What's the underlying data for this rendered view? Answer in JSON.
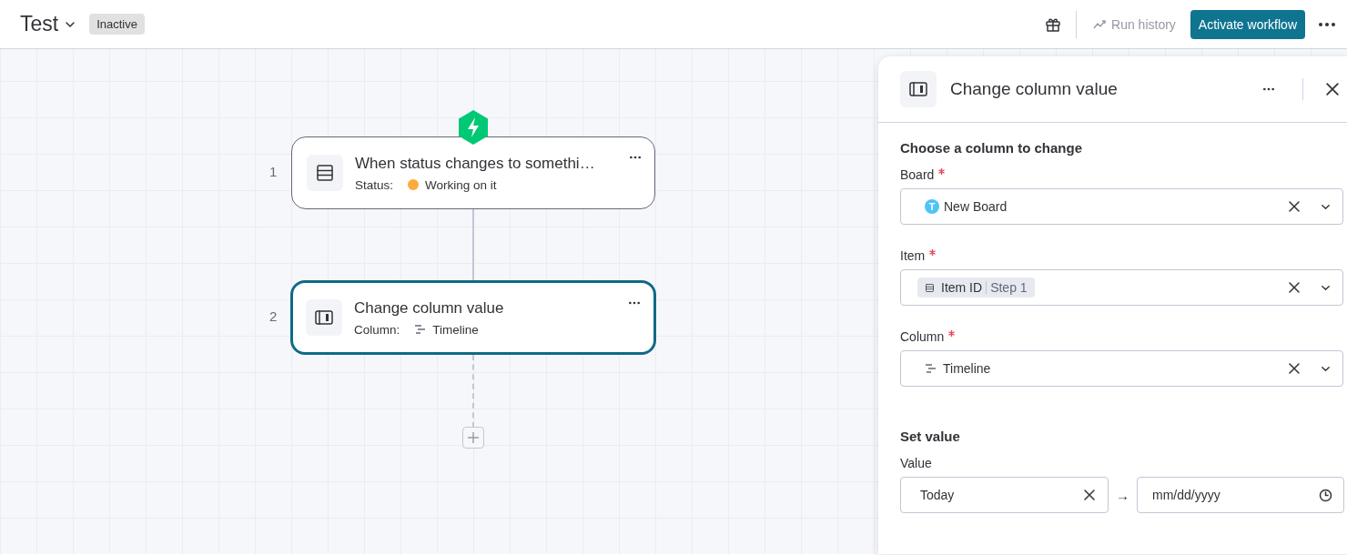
{
  "header": {
    "title": "Test",
    "status_badge": "Inactive",
    "run_history": "Run history",
    "activate_button": "Activate workflow"
  },
  "canvas": {
    "nodes": [
      {
        "number": "1",
        "kind": "trigger",
        "title": "When status changes to somethi…",
        "detail_label": "Status:",
        "detail_value": "Working on it",
        "color": "#fdab3d",
        "selected": false
      },
      {
        "number": "2",
        "kind": "action",
        "title": "Change column value",
        "detail_label": "Column:",
        "detail_value": "Timeline",
        "selected": true
      }
    ]
  },
  "panel": {
    "title": "Change column value",
    "sections": [
      {
        "heading": "Choose a column to change",
        "fields": [
          {
            "label": "Board",
            "required": true,
            "kind": "board",
            "value": "New Board",
            "avatar": "T"
          },
          {
            "label": "Item",
            "required": true,
            "kind": "chip",
            "value": "Item ID",
            "source": "Step 1"
          },
          {
            "label": "Column",
            "required": true,
            "kind": "column",
            "value": "Timeline"
          }
        ]
      },
      {
        "heading": "Set value",
        "fields": [
          {
            "label": "Value",
            "required": false,
            "kind": "range",
            "start": "Today",
            "arrow": "→",
            "end_placeholder": "mm/dd/yyyy"
          }
        ]
      }
    ]
  }
}
